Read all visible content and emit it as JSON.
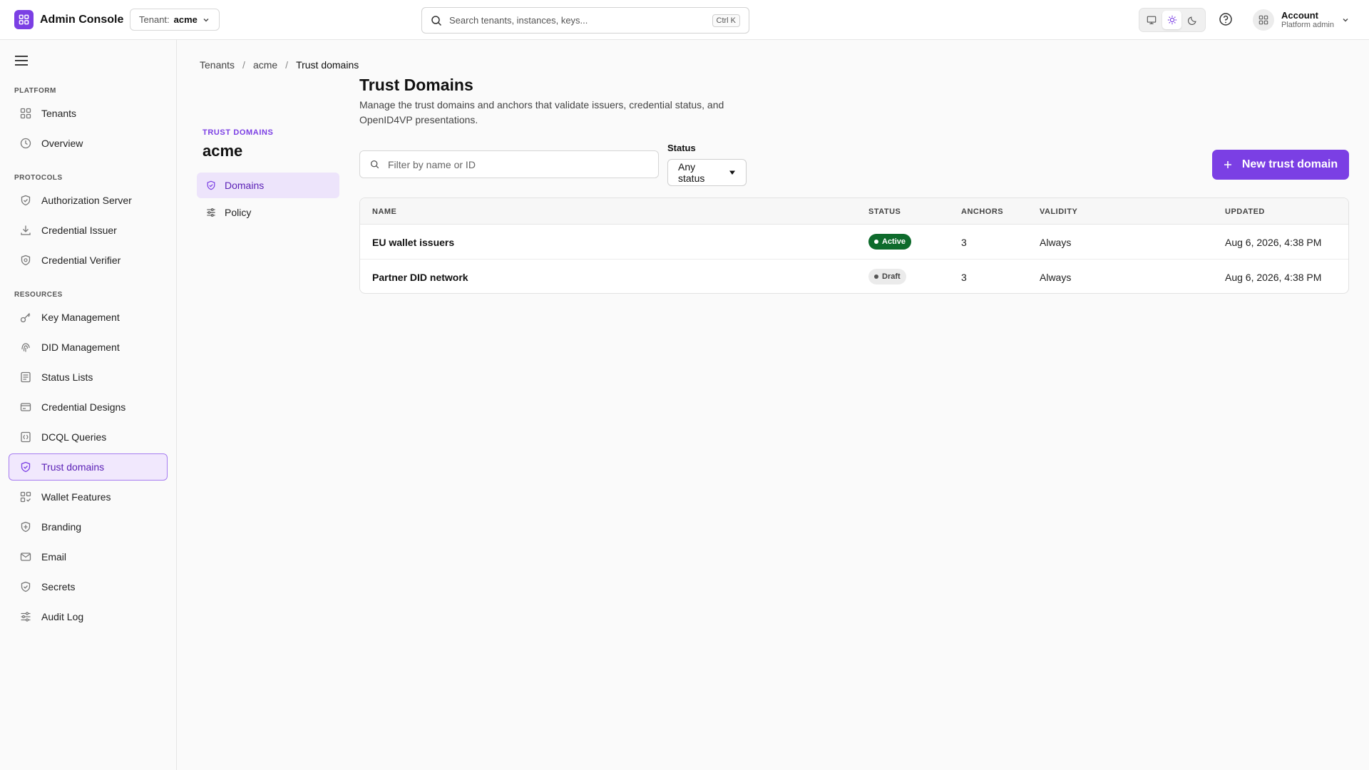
{
  "app": {
    "title": "Admin Console",
    "brand_color": "#7b3fe4"
  },
  "topbar": {
    "tenant_label": "Tenant:",
    "tenant_value": "acme",
    "search_placeholder": "Search tenants, instances, keys...",
    "search_shortcut": "Ctrl K",
    "theme_options": [
      "monitor-icon",
      "sun-icon",
      "moon-icon"
    ],
    "theme_selected": "sun-icon",
    "account_name": "Account",
    "account_role": "Platform admin"
  },
  "sidebar": {
    "sections": [
      {
        "label": "PLATFORM"
      },
      {
        "label": "PROTOCOLS"
      },
      {
        "label": "RESOURCES"
      }
    ],
    "items": [
      {
        "label": "Tenants",
        "icon": "grid-icon"
      },
      {
        "label": "Overview",
        "icon": "clock-icon"
      },
      {
        "label": "Authorization Server",
        "icon": "shield-icon"
      },
      {
        "label": "Credential Issuer",
        "icon": "download-icon"
      },
      {
        "label": "Credential Verifier",
        "icon": "shield-check-icon"
      },
      {
        "label": "Key Management",
        "icon": "key-icon"
      },
      {
        "label": "DID Management",
        "icon": "fingerprint-icon"
      },
      {
        "label": "Status Lists",
        "icon": "list-icon"
      },
      {
        "label": "Credential Designs",
        "icon": "card-icon"
      },
      {
        "label": "DCQL Queries",
        "icon": "query-icon"
      },
      {
        "label": "Trust domains",
        "icon": "shield-check-icon",
        "active": true
      },
      {
        "label": "Wallet Features",
        "icon": "grid-check-icon"
      },
      {
        "label": "Branding",
        "icon": "badge-icon"
      },
      {
        "label": "Email",
        "icon": "mail-icon"
      },
      {
        "label": "Secrets",
        "icon": "shield-check-icon"
      },
      {
        "label": "Audit Log",
        "icon": "sliders-icon"
      }
    ]
  },
  "breadcrumb": [
    "Tenants",
    "acme",
    "Trust domains"
  ],
  "subnav": {
    "eyebrow": "TRUST DOMAINS",
    "title": "acme",
    "items": [
      {
        "label": "Domains",
        "icon": "shield-check-icon",
        "active": true
      },
      {
        "label": "Policy",
        "icon": "sliders-icon"
      }
    ]
  },
  "main": {
    "title": "Trust Domains",
    "description": "Manage the trust domains and anchors that validate issuers, credential status, and OpenID4VP presentations.",
    "filter_placeholder": "Filter by name or ID",
    "status_label": "Status",
    "status_value": "Any status",
    "new_button": "New trust domain"
  },
  "table": {
    "columns": [
      "NAME",
      "STATUS",
      "ANCHORS",
      "VALIDITY",
      "UPDATED"
    ],
    "rows": [
      {
        "name": "EU wallet issuers",
        "status": "Active",
        "anchors": "3",
        "validity": "Always",
        "updated": "Aug 6, 2026, 4:38 PM"
      },
      {
        "name": "Partner DID network",
        "status": "Draft",
        "anchors": "3",
        "validity": "Always",
        "updated": "Aug 6, 2026, 4:38 PM"
      }
    ]
  }
}
